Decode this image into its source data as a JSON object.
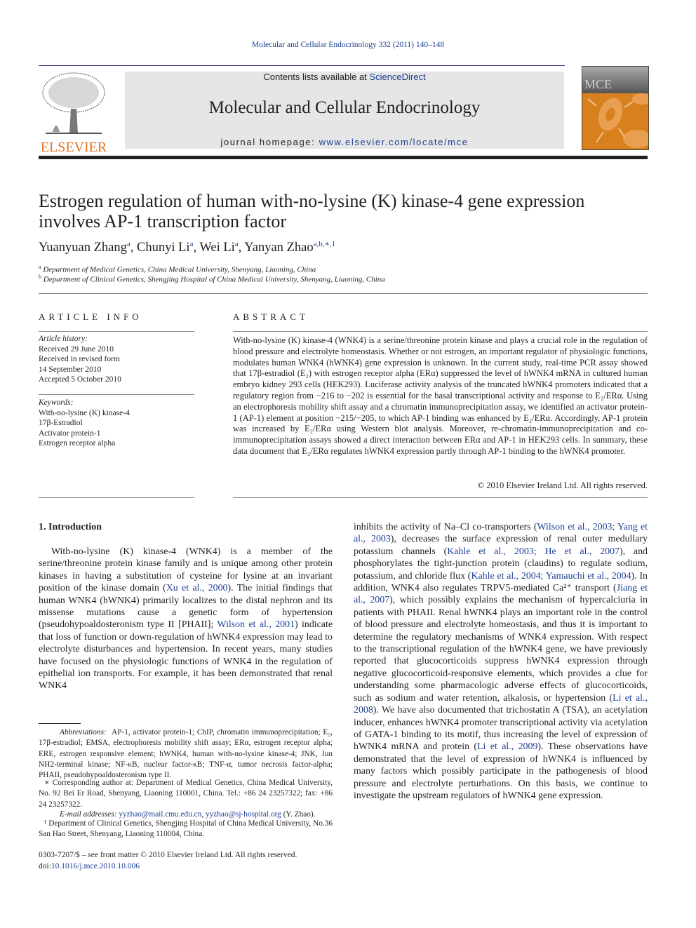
{
  "header": {
    "journal_ref": "Molecular and Cellular Endocrinology 332 (2011) 140–148",
    "contents_prefix": "Contents lists available at ",
    "contents_link": "ScienceDirect",
    "journal_title": "Molecular and Cellular Endocrinology",
    "homepage_prefix": "journal homepage: ",
    "homepage_link": "www.elsevier.com/locate/mce",
    "publisher": "ELSEVIER",
    "cover_abbrev": "MCE",
    "cover_subtitle": "Molecular and Cellular Endocrinology",
    "brand_color": "#e9711c",
    "link_color": "#1c3f94"
  },
  "article": {
    "title": "Estrogen regulation of human with-no-lysine (K) kinase-4 gene expression involves AP-1 transcription factor",
    "authors": [
      {
        "name": "Yuanyuan Zhang",
        "sup": "a"
      },
      {
        "name": "Chunyi Li",
        "sup": "a"
      },
      {
        "name": "Wei Li",
        "sup": "a"
      },
      {
        "name": "Yanyan Zhao",
        "sup": "a,b,∗,1"
      }
    ],
    "affiliations": [
      {
        "sup": "a",
        "text": "Department of Medical Genetics, China Medical University, Shenyang, Liaoning, China"
      },
      {
        "sup": "b",
        "text": "Department of Clinical Genetics, Shengjing Hospital of China Medical University, Shenyang, Liaoning, China"
      }
    ]
  },
  "article_info": {
    "heading": "ARTICLE INFO",
    "history_label": "Article history:",
    "history": [
      "Received 29 June 2010",
      "Received in revised form",
      "14 September 2010",
      "Accepted 5 October 2010"
    ],
    "keywords_label": "Keywords:",
    "keywords": [
      "With-no-lysine (K) kinase-4",
      "17β-Estradiol",
      "Activator protein-1",
      "Estrogen receptor alpha"
    ]
  },
  "abstract": {
    "heading": "ABSTRACT",
    "text": "With-no-lysine (K) kinase-4 (WNK4) is a serine/threonine protein kinase and plays a crucial role in the regulation of blood pressure and electrolyte homeostasis. Whether or not estrogen, an important regulator of physiologic functions, modulates human WNK4 (hWNK4) gene expression is unknown. In the current study, real-time PCR assay showed that 17β-estradiol (E₂) with estrogen receptor alpha (ERα) suppressed the level of hWNK4 mRNA in cultured human embryo kidney 293 cells (HEK293). Luciferase activity analysis of the truncated hWNK4 promoters indicated that a regulatory region from −216 to −202 is essential for the basal transcriptional activity and response to E₂/ERα. Using an electrophoresis mobility shift assay and a chromatin immunoprecipitation assay, we identified an activator protein-1 (AP-1) element at position −215/−205, to which AP-1 binding was enhanced by E₂/ERα. Accordingly, AP-1 protein was increased by E₂/ERα using Western blot analysis. Moreover, re-chromatin-immunoprecipitation and co-immunoprecipitation assays showed a direct interaction between ERα and AP-1 in HEK293 cells. In summary, these data document that E₂/ERα regulates hWNK4 expression partly through AP-1 binding to the hWNK4 promoter.",
    "copyright": "© 2010 Elsevier Ireland Ltd. All rights reserved."
  },
  "introduction": {
    "heading": "1.  Introduction",
    "left_parts": [
      {
        "t": "With-no-lysine (K) kinase-4 (WNK4) is a member of the serine/threonine protein kinase family and is unique among other protein kinases in having a substitution of cysteine for lysine at an invariant position of the kinase domain ("
      },
      {
        "t": "Xu et al., 2000",
        "link": true
      },
      {
        "t": "). The initial findings that human WNK4 (hWNK4) primarily localizes to the distal nephron and its missense mutations cause a genetic form of hypertension (pseudohypoaldosteronism type II [PHAII]; "
      },
      {
        "t": "Wilson et al., 2001",
        "link": true
      },
      {
        "t": ") indicate that loss of function or down-regulation of hWNK4 expression may lead to electrolyte disturbances and hypertension. In recent years, many studies have focused on the physiologic functions of WNK4 in the regulation of epithelial ion transports. For example, it has been demonstrated that renal WNK4"
      }
    ],
    "right_parts": [
      {
        "t": "inhibits the activity of Na–Cl co-transporters ("
      },
      {
        "t": "Wilson et al., 2003; Yang et al., 2003",
        "link": true
      },
      {
        "t": "), decreases the surface expression of renal outer medullary potassium channels ("
      },
      {
        "t": "Kahle et al., 2003; He et al., 2007",
        "link": true
      },
      {
        "t": "), and phosphorylates the tight-junction protein (claudins) to regulate sodium, potassium, and chloride flux ("
      },
      {
        "t": "Kahle et al., 2004; Yamauchi et al., 2004",
        "link": true
      },
      {
        "t": "). In addition, WNK4 also regulates TRPV5-mediated Ca²⁺ transport ("
      },
      {
        "t": "Jiang et al., 2007",
        "link": true
      },
      {
        "t": "), which possibly explains the mechanism of hypercalciuria in patients with PHAII. Renal hWNK4 plays an important role in the control of blood pressure and electrolyte homeostasis, and thus it is important to determine the regulatory mechanisms of WNK4 expression. With respect to the transcriptional regulation of the hWNK4 gene, we have previously reported that glucocorticoids suppress hWNK4 expression through negative glucocorticoid-responsive elements, which provides a clue for understanding some pharmacologic adverse effects of glucocorticoids, such as sodium and water retention, alkalosis, or hypertension ("
      },
      {
        "t": "Li et al., 2008",
        "link": true
      },
      {
        "t": "). We have also documented that trichostatin A (TSA), an acetylation inducer, enhances hWNK4 promoter transcriptional activity via acetylation of GATA-1 binding to its motif, thus increasing the level of expression of hWNK4 mRNA and protein ("
      },
      {
        "t": "Li et al., 2009",
        "link": true
      },
      {
        "t": "). These observations have demonstrated that the level of expression of hWNK4 is influenced by many factors which possibly participate in the pathogenesis of blood pressure and electrolyte perturbations. On this basis, we continue to investigate the upstream regulators of hWNK4 gene expression."
      }
    ]
  },
  "footnotes": {
    "abbrev_label": "Abbreviations:",
    "abbrev_text": "AP-1, activator protein-1; ChIP, chromatin immunoprecipitation; E₂, 17β-estradiol; EMSA, electrophoresis mobility shift assay; ERα, estrogen receptor alpha; ERE, estrogen responsive element; hWNK4, human with-no-lysine kinase-4; JNK, Jun NH2-terminal kinase; NF-κB, nuclear factor-κB; TNF-α, tumor necrosis factor-alpha; PHAII, pseudohypoaldosteronism type II.",
    "corresponding": "∗ Corresponding author at: Department of Medical Genetics, China Medical University, No. 92 Bei Er Road, Shenyang, Liaoning 110001, China. Tel.: +86 24 23257322; fax: +86 24 23257322.",
    "email_label": "E-mail addresses:",
    "email1": "yyzhao@mail.cmu.edu.cn",
    "email2": "yyzhao@sj-hospital.org",
    "email_suffix": " (Y. Zhao).",
    "note1": "¹  Department of Clinical Genetics, Shengjing Hospital of China Medical University, No.36 San Hao Street, Shenyang, Liaoning 110004, China.",
    "front_matter": "0303-7207/$ – see front matter © 2010 Elsevier Ireland Ltd. All rights reserved.",
    "doi_label": "doi:",
    "doi": "10.1016/j.mce.2010.10.006"
  }
}
